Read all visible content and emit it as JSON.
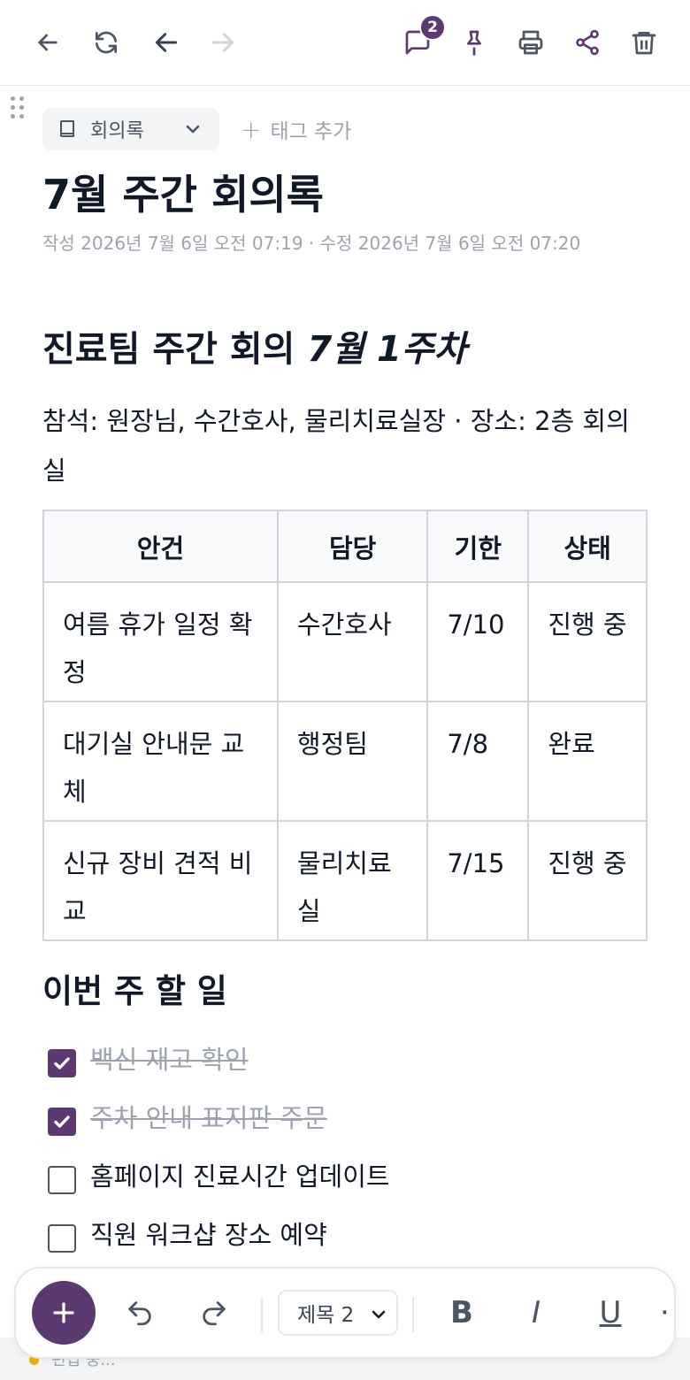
{
  "toolbar": {
    "comment_count": "2",
    "colors": {
      "accent": "#5b3a72",
      "icon": "#4b5563",
      "disabled": "#cbd5e1"
    },
    "icons": [
      "back-arrow-icon",
      "refresh-icon",
      "undo-arrow-icon",
      "redo-arrow-icon",
      "comment-icon",
      "pin-icon",
      "print-icon",
      "share-icon",
      "trash-icon"
    ]
  },
  "notebook": {
    "label": "회의록"
  },
  "tags": {
    "add_label": "태그 추가"
  },
  "note": {
    "title": "7월 주간 회의록",
    "meta": "작성 2026년 7월 6일 오전 07:19 · 수정 2026년 7월 6일 오전 07:20",
    "heading_plain": "진료팀 주간 회의 ",
    "heading_italic": "7월 1주차",
    "attendees": "참석: 원장님, 수간호사, 물리치료실장 · 장소: 2층 회의실",
    "table": {
      "headers": [
        "안건",
        "담당",
        "기한",
        "상태"
      ],
      "rows": [
        [
          "여름 휴가 일정 확정",
          "수간호사",
          "7/10",
          "진행 중"
        ],
        [
          "대기실 안내문 교체",
          "행정팀",
          "7/8",
          "완료"
        ],
        [
          "신규 장비 견적 비교",
          "물리치료실",
          "7/15",
          "진행 중"
        ]
      ]
    },
    "todo_heading": "이번 주 할 일",
    "todos": [
      {
        "text": "백신 재고 확인",
        "checked": true
      },
      {
        "text": "주차 안내 표지판 주문",
        "checked": true
      },
      {
        "text": "홈페이지 진료시간 업데이트",
        "checked": false
      },
      {
        "text": "직원 워크샵 장소 예약",
        "checked": false
      }
    ]
  },
  "format_bar": {
    "heading_select": "제목 2",
    "bold": "B",
    "italic": "I",
    "underline": "U"
  },
  "status": {
    "text": "편집 중..."
  }
}
